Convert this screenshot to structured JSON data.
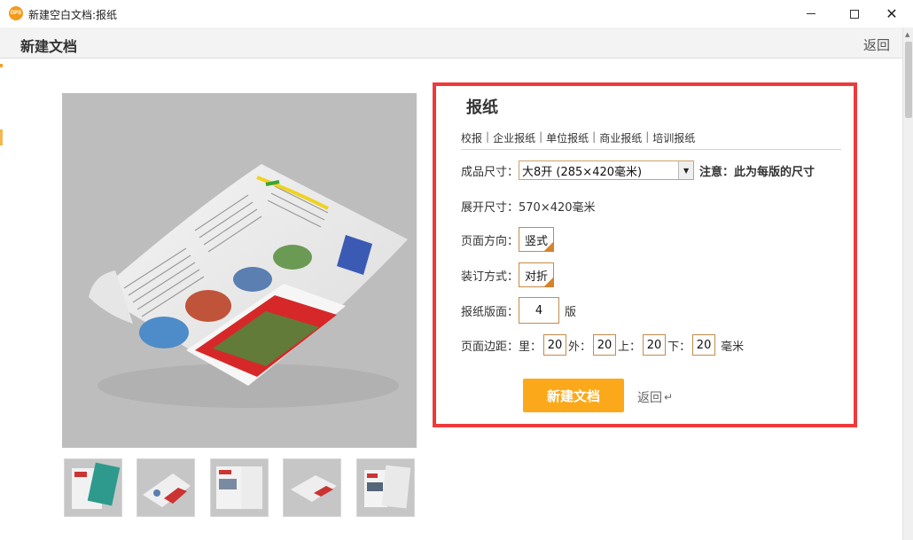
{
  "window": {
    "app_icon_text": "DPS",
    "title": "新建空白文档:报纸",
    "close_glyph": "✕"
  },
  "header": {
    "title": "新建文档",
    "back_label": "返回"
  },
  "panel": {
    "title": "报纸",
    "categories": [
      "校报",
      "企业报纸",
      "单位报纸",
      "商业报纸",
      "培训报纸"
    ],
    "category_separator": "|",
    "size": {
      "label": "成品尺寸：",
      "selected": "大8开 (285×420毫米)",
      "note": "注意：此为每版的尺寸"
    },
    "expanded": {
      "label": "展开尺寸：",
      "value": "570×420毫米"
    },
    "orientation": {
      "label": "页面方向：",
      "value": "竖式"
    },
    "binding": {
      "label": "装订方式：",
      "value": "对折"
    },
    "pages": {
      "label": "报纸版面：",
      "value": "4",
      "unit": "版"
    },
    "margins": {
      "label": "页面边距：",
      "inner_label": "里：",
      "inner": "20",
      "outer_label": "外：",
      "outer": "20",
      "top_label": "上：",
      "top": "20",
      "bottom_label": "下：",
      "bottom": "20",
      "unit": "毫米"
    },
    "create_label": "新建文档",
    "back_label": "返回",
    "enter_glyph": "↵"
  },
  "colors": {
    "panel_border": "#ee3a3a",
    "create_button": "#fba91b",
    "field_border": "#c58a4a"
  }
}
